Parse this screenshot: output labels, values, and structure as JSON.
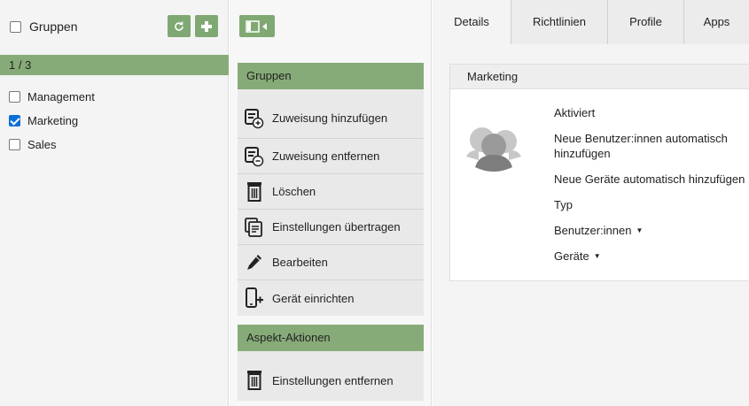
{
  "left_pane": {
    "header_label": "Gruppen",
    "counter": "1 / 3",
    "items": [
      {
        "label": "Management",
        "checked": false
      },
      {
        "label": "Marketing",
        "checked": true
      },
      {
        "label": "Sales",
        "checked": false
      }
    ],
    "buttons": {
      "refresh_icon": "refresh-icon",
      "add_icon": "plus-icon"
    }
  },
  "middle_pane": {
    "toggle_icon": "sidebar-collapse-icon",
    "sections": [
      {
        "title": "Gruppen",
        "actions": [
          {
            "label": "Zuweisung hinzufügen",
            "icon": "assign-add-icon"
          },
          {
            "label": "Zuweisung entfernen",
            "icon": "assign-remove-icon"
          },
          {
            "label": "Löschen",
            "icon": "trash-icon"
          },
          {
            "label": "Einstellungen übertragen",
            "icon": "copy-settings-icon"
          },
          {
            "label": "Bearbeiten",
            "icon": "pencil-icon"
          },
          {
            "label": "Gerät einrichten",
            "icon": "device-add-icon"
          }
        ]
      },
      {
        "title": "Aspekt-Aktionen",
        "actions": [
          {
            "label": "Einstellungen entfernen",
            "icon": "trash-icon"
          }
        ]
      }
    ]
  },
  "right_pane": {
    "tabs": [
      {
        "label": "Details",
        "active": true
      },
      {
        "label": "Richtlinien",
        "active": false
      },
      {
        "label": "Profile",
        "active": false
      },
      {
        "label": "Apps",
        "active": false
      }
    ],
    "card": {
      "title": "Marketing",
      "avatar_icon": "group-avatar-icon",
      "fields": [
        {
          "label": "Aktiviert",
          "dropdown": false
        },
        {
          "label": "Neue Benutzer:innen automatisch hinzufügen",
          "dropdown": false
        },
        {
          "label": "Neue Geräte automatisch hinzufügen",
          "dropdown": false
        },
        {
          "label": "Typ",
          "dropdown": false
        },
        {
          "label": "Benutzer:innen",
          "dropdown": true
        },
        {
          "label": "Geräte",
          "dropdown": true
        }
      ]
    }
  },
  "colors": {
    "accent_green": "#87ab78",
    "button_green": "#80a873",
    "checkbox_blue": "#0b6fd6"
  }
}
